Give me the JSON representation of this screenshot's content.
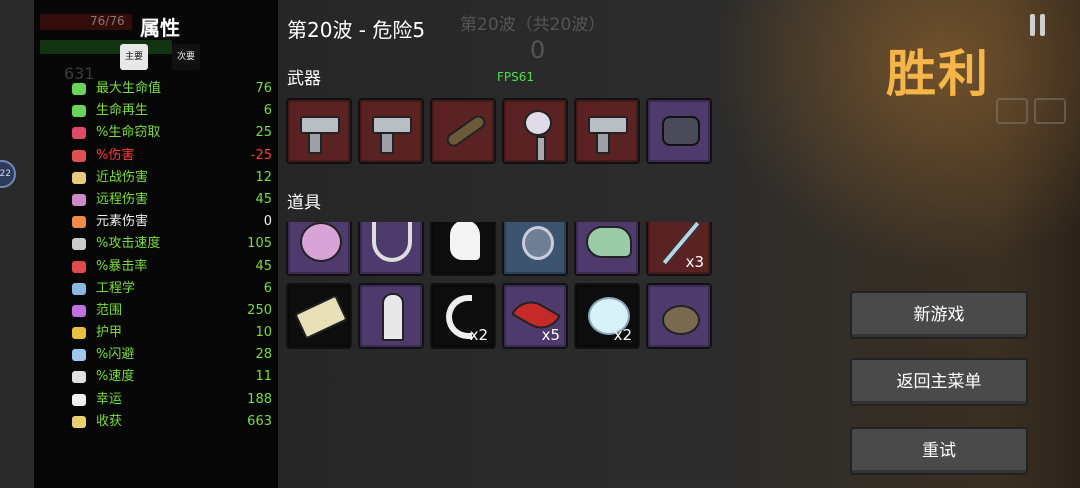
{
  "stats_panel": {
    "hp_text": "76/76",
    "title": "属性",
    "tab_primary": "主要",
    "tab_secondary": "次要",
    "materials": "631",
    "stats": [
      {
        "label": "最大生命值",
        "value": "76",
        "tone": "positive",
        "icon": "heart-icon",
        "color": "#6ad35a"
      },
      {
        "label": "生命再生",
        "value": "6",
        "tone": "positive",
        "icon": "regen-icon",
        "color": "#6ad35a"
      },
      {
        "label": "%生命窃取",
        "value": "25",
        "tone": "positive",
        "icon": "fang-icon",
        "color": "#e04a6a"
      },
      {
        "label": "%伤害",
        "value": "-25",
        "tone": "negative",
        "icon": "damage-icon",
        "color": "#e05050"
      },
      {
        "label": "近战伤害",
        "value": "12",
        "tone": "positive",
        "icon": "sword-icon",
        "color": "#e8c87a"
      },
      {
        "label": "远程伤害",
        "value": "45",
        "tone": "positive",
        "icon": "bow-icon",
        "color": "#d08ac8"
      },
      {
        "label": "元素伤害",
        "value": "0",
        "tone": "neutral",
        "icon": "flame-icon",
        "color": "#f08a4a"
      },
      {
        "label": "%攻击速度",
        "value": "105",
        "tone": "positive",
        "icon": "hourglass-icon",
        "color": "#cccccc"
      },
      {
        "label": "%暴击率",
        "value": "45",
        "tone": "positive",
        "icon": "crit-icon",
        "color": "#e04a4a"
      },
      {
        "label": "工程学",
        "value": "6",
        "tone": "positive",
        "icon": "wrench-icon",
        "color": "#8ab8e0"
      },
      {
        "label": "范围",
        "value": "250",
        "tone": "positive",
        "icon": "range-icon",
        "color": "#c070e0"
      },
      {
        "label": "护甲",
        "value": "10",
        "tone": "positive",
        "icon": "shield-icon",
        "color": "#e8c040"
      },
      {
        "label": "%闪避",
        "value": "28",
        "tone": "positive",
        "icon": "dodge-icon",
        "color": "#a0c8e8"
      },
      {
        "label": "%速度",
        "value": "11",
        "tone": "positive",
        "icon": "speed-icon",
        "color": "#e0e0e0"
      },
      {
        "label": "幸运",
        "value": "188",
        "tone": "positive",
        "icon": "dice-icon",
        "color": "#f0f0f0"
      },
      {
        "label": "收获",
        "value": "663",
        "tone": "positive",
        "icon": "harvest-icon",
        "color": "#e8d070"
      }
    ]
  },
  "header": {
    "wave_title": "第20波 - 危险5",
    "ghost_wave": "第20波（共20波）",
    "ghost_counter": "0",
    "fps": "FPS61"
  },
  "weapons": {
    "label": "武器",
    "slots": [
      {
        "name": "weapon-slot-gun-1",
        "bg": "red",
        "icon": "gun"
      },
      {
        "name": "weapon-slot-gun-2",
        "bg": "red",
        "icon": "gun"
      },
      {
        "name": "weapon-slot-launcher",
        "bg": "red",
        "icon": "tube"
      },
      {
        "name": "weapon-slot-skull-staff",
        "bg": "red",
        "icon": "skull"
      },
      {
        "name": "weapon-slot-gun-3",
        "bg": "red",
        "icon": "gun"
      },
      {
        "name": "weapon-slot-minigun",
        "bg": "purple",
        "icon": "minigun"
      }
    ]
  },
  "items": {
    "label": "道具",
    "slots": [
      {
        "name": "item-slot-brain",
        "bg": "purple",
        "icon": "blob",
        "count": ""
      },
      {
        "name": "item-slot-wings",
        "bg": "purple",
        "icon": "wings",
        "count": ""
      },
      {
        "name": "item-slot-ghost",
        "bg": "black",
        "icon": "ghost",
        "count": ""
      },
      {
        "name": "item-slot-potion",
        "bg": "blue",
        "icon": "potion",
        "count": ""
      },
      {
        "name": "item-slot-chameleon",
        "bg": "purple",
        "icon": "chameleon",
        "count": ""
      },
      {
        "name": "item-slot-sword",
        "bg": "red",
        "icon": "sword",
        "count": "x3"
      },
      {
        "name": "item-slot-ticket",
        "bg": "black",
        "icon": "ticket",
        "count": ""
      },
      {
        "name": "item-slot-statue",
        "bg": "purple",
        "icon": "statue",
        "count": ""
      },
      {
        "name": "item-slot-fang",
        "bg": "black",
        "icon": "fang",
        "count": "x2"
      },
      {
        "name": "item-slot-leaf",
        "bg": "purple",
        "icon": "leaf",
        "count": "x5"
      },
      {
        "name": "item-slot-bubble",
        "bg": "black",
        "icon": "bubble",
        "count": "x2"
      },
      {
        "name": "item-slot-stump",
        "bg": "purple",
        "icon": "stump",
        "count": ""
      }
    ]
  },
  "result": {
    "title": "胜利",
    "buttons": {
      "new_game": "新游戏",
      "main_menu": "返回主菜单",
      "retry": "重试"
    }
  }
}
